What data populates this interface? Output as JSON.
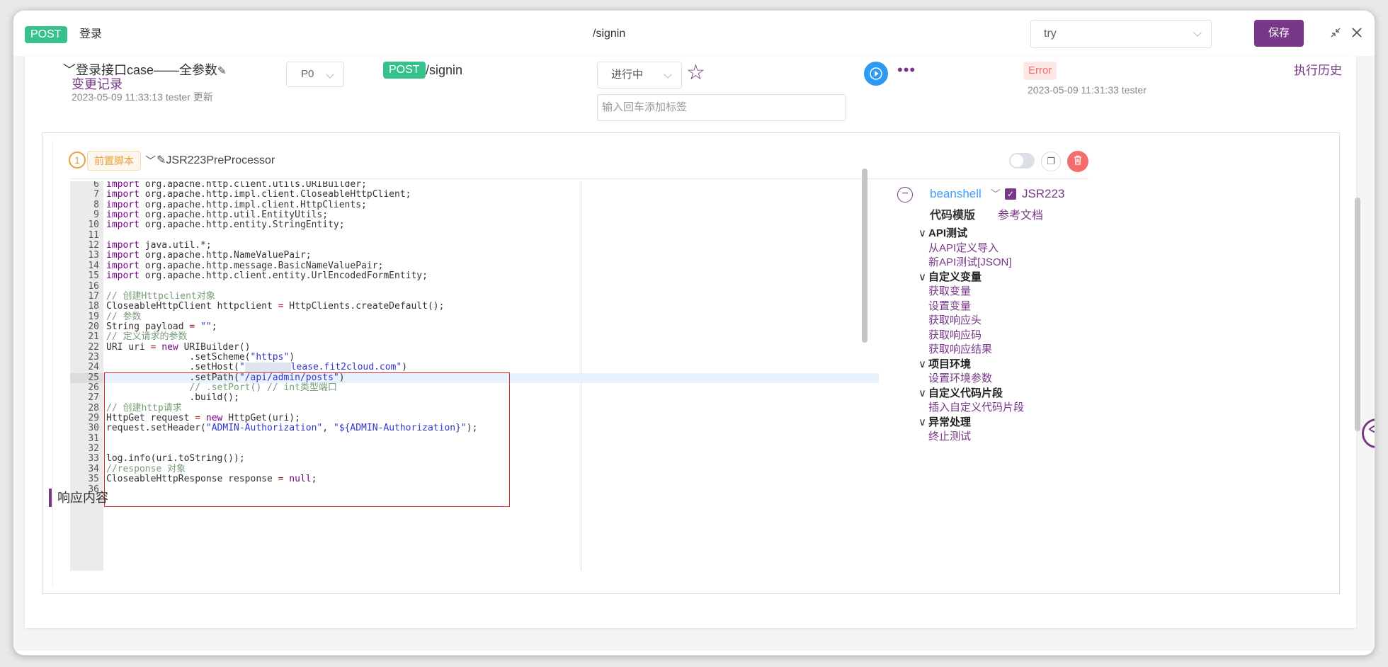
{
  "topbar": {
    "method": "POST",
    "name": "登录",
    "path": "/signin",
    "env_value": "try",
    "save_label": "保存"
  },
  "case": {
    "title": "登录接口case——全参数",
    "change_log": "变更记录",
    "updated_at": "2023-05-09 11:33:13 tester 更新",
    "priority": "P0",
    "method": "POST",
    "path": "/signin",
    "status": "进行中",
    "tag_placeholder": "输入回车添加标签",
    "last_result": "Error",
    "last_run": "2023-05-09 11:31:33 tester",
    "history_label": "执行历史"
  },
  "processor": {
    "step": "1",
    "type_tag": "前置脚本",
    "name": "JSR223PreProcessor"
  },
  "editor": {
    "lines": [
      {
        "n": "6",
        "t": "import org.apache.http.client.utils.URIBuilder;"
      },
      {
        "n": "7",
        "t": "import org.apache.http.impl.client.CloseableHttpClient;"
      },
      {
        "n": "8",
        "t": "import org.apache.http.impl.client.HttpClients;"
      },
      {
        "n": "9",
        "t": "import org.apache.http.util.EntityUtils;"
      },
      {
        "n": "10",
        "t": "import org.apache.http.entity.StringEntity;"
      },
      {
        "n": "11",
        "t": ""
      },
      {
        "n": "12",
        "t": "import java.util.*;"
      },
      {
        "n": "13",
        "t": "import org.apache.http.NameValuePair;"
      },
      {
        "n": "14",
        "t": "import org.apache.http.message.BasicNameValuePair;"
      },
      {
        "n": "15",
        "t": "import org.apache.http.client.entity.UrlEncodedFormEntity;"
      },
      {
        "n": "16",
        "t": ""
      },
      {
        "n": "17",
        "t": "// 创建Httpclient对象"
      },
      {
        "n": "18",
        "t": "CloseableHttpClient httpclient = HttpClients.createDefault();"
      },
      {
        "n": "19",
        "t": "// 参数"
      },
      {
        "n": "20",
        "t": "String payload = \"\";"
      },
      {
        "n": "21",
        "t": "// 定义请求的参数"
      },
      {
        "n": "22",
        "t": "URI uri = new URIBuilder()"
      },
      {
        "n": "23",
        "t": "               .setScheme(\"https\")"
      },
      {
        "n": "24",
        "t": "               .setHost(\"lease.fit2cloud.com\")"
      },
      {
        "n": "25",
        "t": "               .setPath(\"/api/admin/posts\")"
      },
      {
        "n": "26",
        "t": "               // .setPort() // int类型端口"
      },
      {
        "n": "27",
        "t": "               .build();"
      },
      {
        "n": "28",
        "t": "// 创建http请求"
      },
      {
        "n": "29",
        "t": "HttpGet request = new HttpGet(uri);"
      },
      {
        "n": "30",
        "t": "request.setHeader(\"ADMIN-Authorization\", \"${ADMIN-Authorization}\");"
      },
      {
        "n": "31",
        "t": ""
      },
      {
        "n": "32",
        "t": ""
      },
      {
        "n": "33",
        "t": "log.info(uri.toString());"
      },
      {
        "n": "34",
        "t": "//response 对象"
      },
      {
        "n": "35",
        "t": "CloseableHttpResponse response = null;"
      },
      {
        "n": "36",
        "t": ""
      }
    ],
    "active_line": "25"
  },
  "template": {
    "language": "beanshell",
    "engine": "JSR223",
    "title": "代码模版",
    "ref_doc": "参考文档",
    "groups": [
      {
        "label": "API测试",
        "items": [
          "从API定义导入",
          "新API测试[JSON]"
        ]
      },
      {
        "label": "自定义变量",
        "items": [
          "获取变量",
          "设置变量",
          "获取响应头",
          "获取响应码",
          "获取响应结果"
        ]
      },
      {
        "label": "项目环境",
        "items": [
          "设置环境参数"
        ]
      },
      {
        "label": "自定义代码片段",
        "items": [
          "插入自定义代码片段"
        ]
      },
      {
        "label": "异常处理",
        "items": [
          "终止测试"
        ]
      }
    ]
  },
  "response": {
    "title": "响应内容"
  }
}
